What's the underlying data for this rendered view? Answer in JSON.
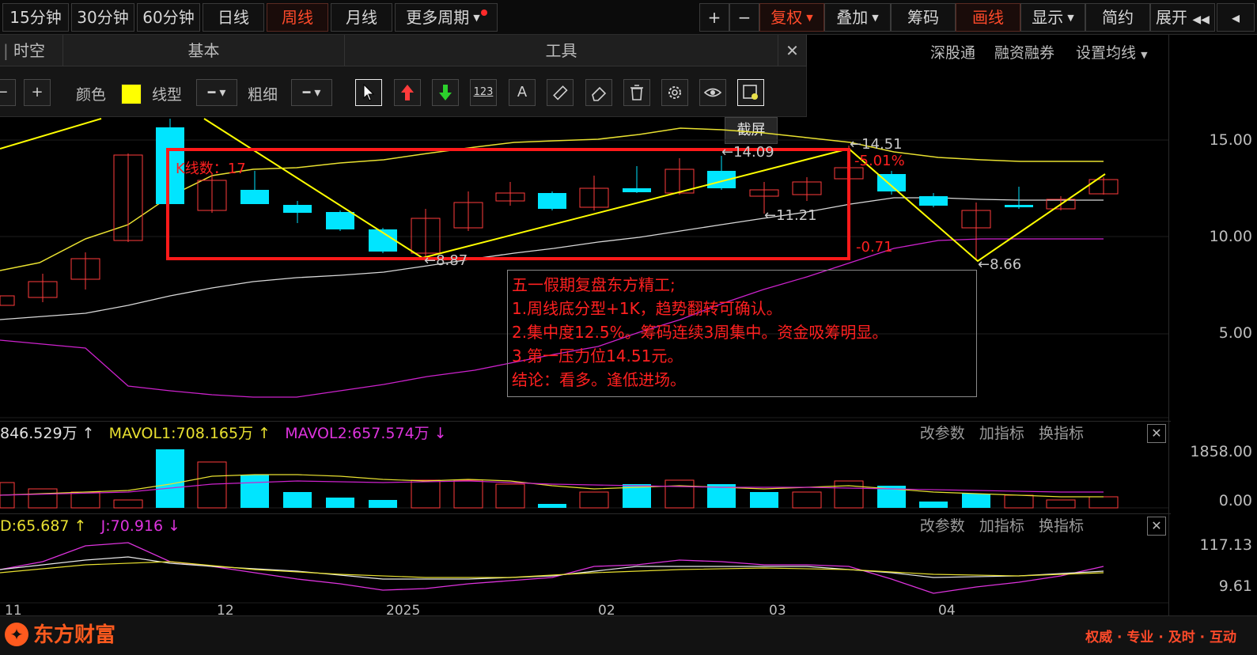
{
  "toolbar": {
    "periods": [
      "15分钟",
      "30分钟",
      "60分钟",
      "日线",
      "周线",
      "月线",
      "更多周期"
    ],
    "right": [
      "+",
      "−",
      "复权",
      "叠加",
      "筹码",
      "画线",
      "显示",
      "简约",
      "展开"
    ]
  },
  "panel": {
    "tabs": [
      "时空",
      "基本",
      "工具"
    ],
    "color_label": "颜色",
    "linetype_label": "线型",
    "thickness_label": "粗细",
    "tools": [
      "arrow-cursor-icon",
      "up-arrow-icon",
      "down-arrow-icon",
      "number-label-icon",
      "text-icon",
      "ruler-icon",
      "eraser-icon",
      "trash-icon",
      "settings-icon",
      "eye-icon",
      "screenshot-icon"
    ],
    "tool_123": "123",
    "tool_text": "A",
    "close": "✕",
    "tooltip": "截屏"
  },
  "toplinks": [
    "深股通",
    "融资融券",
    "设置均线"
  ],
  "chart": {
    "price_labels": [
      "15.00",
      "10.00",
      "5.00"
    ],
    "k_count": "K线数：17",
    "annotations": [
      "←14.09",
      "←14.51",
      "-5.01%",
      "←11.21",
      "-0.71",
      "←8.87",
      "←8.66"
    ],
    "line_color": "#ffff00",
    "box_color": "#ff2020",
    "up_color": "#ff3b3b",
    "down_color": "#00e5ff"
  },
  "note": {
    "lines": [
      "五一假期复盘东方精工;",
      "1.周线底分型+1K，趋势翻转可确认。",
      "2.集中度12.5%。筹码连续3周集中。资金吸筹明显。",
      "3.第一压力位14.51元。",
      "结论：看多。逢低进场。"
    ]
  },
  "vol": {
    "vol": "846.529万",
    "mavol1": "MAVOL1:708.165万",
    "mavol2": "MAVOL2:657.574万",
    "axis": [
      "1858.00",
      "0.00"
    ]
  },
  "kdj": {
    "d": "D:65.687",
    "j": "J:70.916",
    "axis": [
      "117.13",
      "9.61"
    ]
  },
  "ind_links": [
    "改参数",
    "加指标",
    "换指标"
  ],
  "xaxis": [
    "11",
    "12",
    "2025",
    "02",
    "03",
    "04"
  ],
  "footer": {
    "logo": "东方财富",
    "slogan": "权威 · 专业 · 及时 · 互动"
  }
}
